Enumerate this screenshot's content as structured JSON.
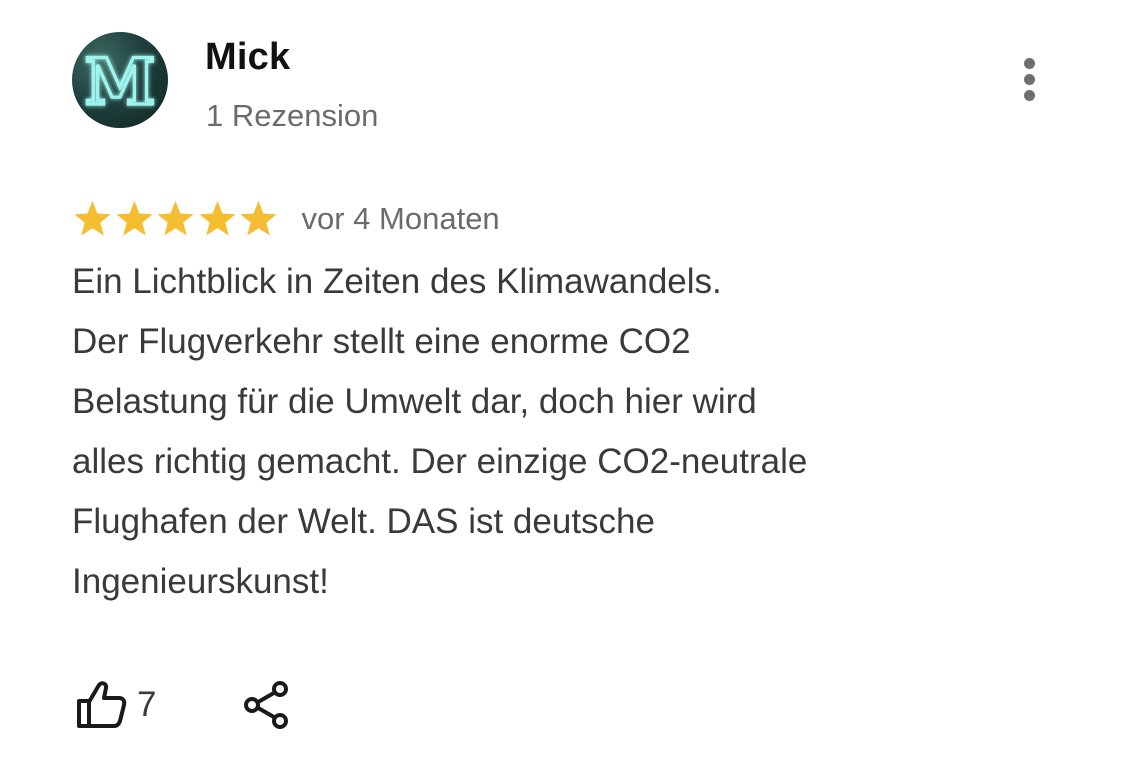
{
  "review": {
    "author": {
      "name": "Mick",
      "avatar_letter": "M",
      "review_count_label": "1 Rezension"
    },
    "menu_icon": "more-vertical-icon",
    "rating": 5,
    "rating_max": 5,
    "date": "vor 4 Monaten",
    "text_lines": [
      "Ein Lichtblick in Zeiten des Klimawandels.",
      "Der Flugverkehr stellt eine enorme CO2",
      "Belastung für die Umwelt dar, doch hier wird",
      "alles richtig gemacht. Der einzige CO2-neutrale",
      "Flughafen der Welt. DAS ist deutsche",
      "Ingenieurskunst!"
    ],
    "likes": {
      "icon": "thumbs-up-icon",
      "count": "7"
    },
    "share": {
      "icon": "share-icon"
    }
  },
  "colors": {
    "star": "#F5BE32",
    "secondary_text": "#6B6B6B",
    "body_text": "#3A3A3A",
    "avatar_neon": "#9FF4F0"
  }
}
